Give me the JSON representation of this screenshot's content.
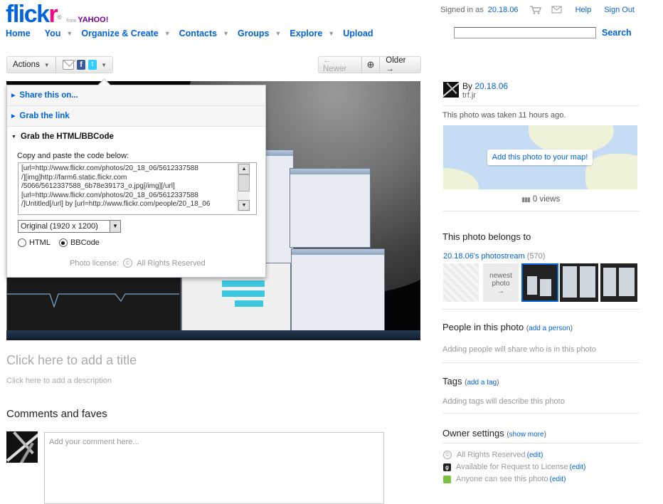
{
  "brand": {
    "logo_main": "flick",
    "logo_r": "r",
    "logo_from": "from",
    "logo_yahoo": "YAHOO!"
  },
  "top_links": {
    "signed_in_prefix": "Signed in as",
    "user": "20.18.06",
    "help": "Help",
    "sign_out": "Sign Out"
  },
  "nav": {
    "home": "Home",
    "you": "You",
    "organize": "Organize & Create",
    "contacts": "Contacts",
    "groups": "Groups",
    "explore": "Explore",
    "upload": "Upload"
  },
  "search": {
    "value": "",
    "button": "Search"
  },
  "toolbar": {
    "actions": "Actions",
    "newer": "← Newer",
    "older": "Older →"
  },
  "share_popup": {
    "share_on": "Share this on...",
    "grab_link": "Grab the link",
    "grab_html": "Grab the HTML/BBCode",
    "copy_label": "Copy and paste the code below:",
    "code": "[url=http://www.flickr.com/photos/20_18_06/5612337588\n/][img]http://farm6.static.flickr.com\n/5066/5612337588_6b78e39173_o.jpg[/img][/url]\n[url=http://www.flickr.com/photos/20_18_06/5612337588\n/]Untitled[/url] by [url=http://www.flickr.com/people/20_18_06",
    "size_select": "Original (1920 x 1200)",
    "radio_html": "HTML",
    "radio_bbcode": "BBCode",
    "license_label": "Photo license:",
    "license_value": "All Rights Reserved"
  },
  "photo_meta": {
    "title_placeholder": "Click here to add a title",
    "desc_placeholder": "Click here to add a description"
  },
  "comments": {
    "heading": "Comments and faves",
    "placeholder": "Add your comment here..."
  },
  "owner": {
    "by_prefix": "By",
    "username": "20.18.06",
    "realname": "trf.jr",
    "taken": "This photo was taken 11 hours ago.",
    "map_button": "Add this photo to your map!",
    "views": "0 views"
  },
  "belongs": {
    "heading": "This photo belongs to",
    "stream": "20.18.06's photostream",
    "stream_count": "(570)",
    "newest_line1": "newest",
    "newest_line2": "photo",
    "newest_arrow": "→"
  },
  "people": {
    "heading": "People in this photo",
    "add_link": "add a person",
    "hint": "Adding people will share who is in this photo"
  },
  "tags": {
    "heading": "Tags",
    "add_link": "add a tag",
    "hint": "Adding tags will describe this photo"
  },
  "owner_settings": {
    "heading": "Owner settings",
    "show_more": "show more",
    "rows": [
      {
        "text": "All Rights Reserved",
        "edit": "edit"
      },
      {
        "text": "Available for Request to License",
        "edit": "edit"
      },
      {
        "text": "Anyone can see this photo",
        "edit": "edit"
      }
    ]
  },
  "colors": {
    "link": "#0063dc",
    "pink": "#ff0084",
    "green": "#7ac142"
  }
}
